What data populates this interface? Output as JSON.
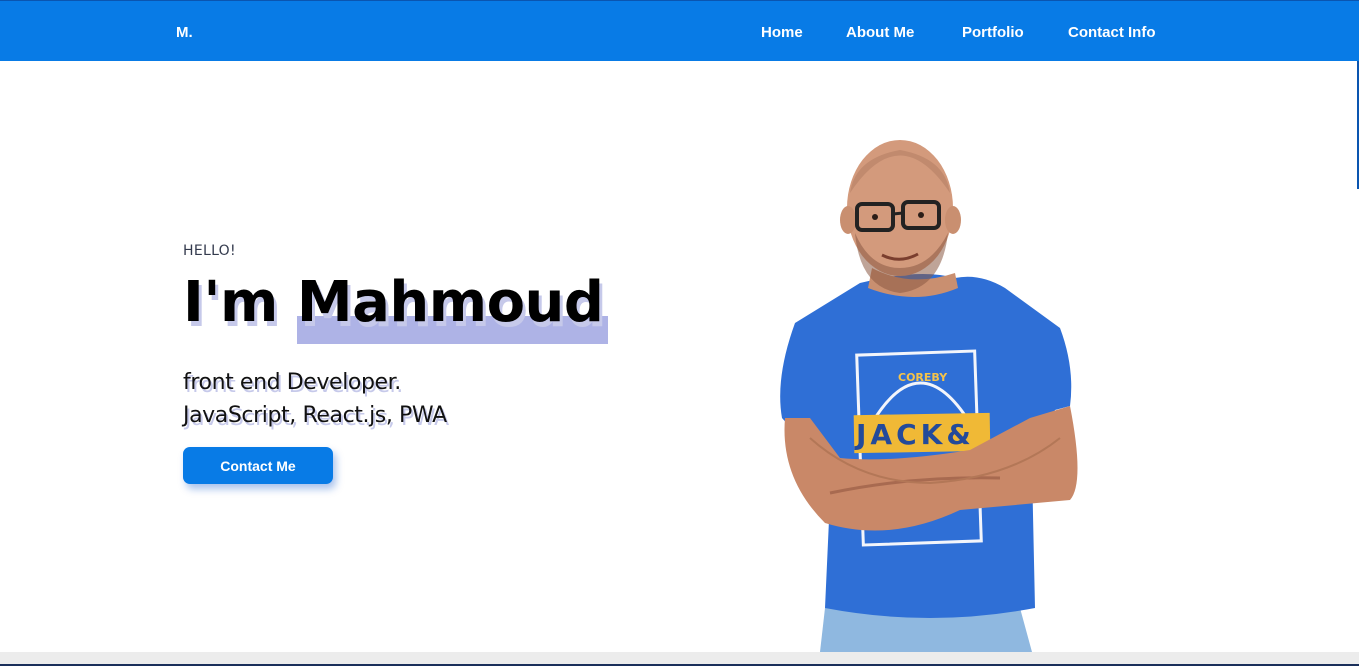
{
  "navbar": {
    "brand": "M.",
    "links": [
      {
        "label": "Home"
      },
      {
        "label": "About Me"
      },
      {
        "label": "Portfolio"
      },
      {
        "label": "Contact Info"
      }
    ],
    "background_color": "#087be6"
  },
  "hero": {
    "greeting": "HELLO!",
    "title_prefix": "I'm",
    "title_name": "Mahmoud",
    "role_line1": "front end Developer.",
    "role_line2": "JavaScript, React.js, PWA",
    "cta_label": "Contact Me",
    "highlight_color": "#aeb3e6"
  },
  "portrait": {
    "shirt_text_top": "COREBY",
    "shirt_text_band": "JACK&"
  }
}
